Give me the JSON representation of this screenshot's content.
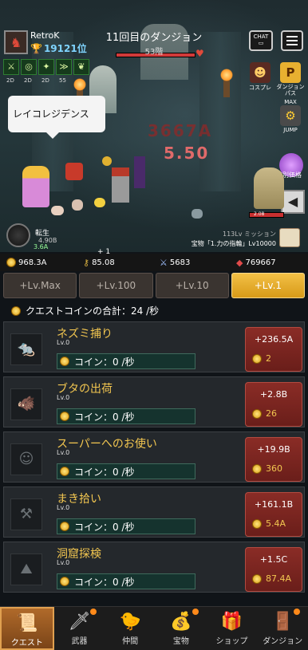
{
  "player": {
    "name": "RetroK",
    "rank": "19121位"
  },
  "dungeon": {
    "title": "11回目のダンジョン",
    "floor": "53階"
  },
  "top_buttons": {
    "chat": "CHAT"
  },
  "buffs": [
    {
      "icon": "crossed-swords-icon",
      "glyph": "⚔",
      "lv": "2D"
    },
    {
      "icon": "coin-buff-icon",
      "glyph": "◎",
      "lv": "2D"
    },
    {
      "icon": "speed-buff-icon",
      "glyph": "✦",
      "lv": "2D"
    },
    {
      "icon": "boots-buff-icon",
      "glyph": "≫",
      "lv": "55"
    },
    {
      "icon": "sprout-buff-icon",
      "glyph": "❦",
      "lv": ""
    }
  ],
  "side_icons": {
    "costume": "コスプレ",
    "dungeon_pass": "ダンジョン パス",
    "jump": "JUMP",
    "max": "MAX",
    "special_price": "特別価格"
  },
  "speech_bubble": "レイコレジデンス",
  "damage": {
    "big": "3667A",
    "small": "5.50"
  },
  "boss_hp_label": "2.08",
  "reincarnation": {
    "label": "転生",
    "value": "4.90B",
    "sub": "3.6A"
  },
  "mission": {
    "line1": "113Lv ミッション",
    "line2": "宝物「1.力の指輪」Lv10000"
  },
  "currency": {
    "coins": "968.3A",
    "keys": "85.08",
    "keys_gain": "+ 1",
    "swords": "5683",
    "gems": "769667"
  },
  "level_tabs": [
    "+Lv.Max",
    "+Lv.100",
    "+Lv.10",
    "+Lv.1"
  ],
  "active_level_tab": 3,
  "quest_total": "クエストコインの合計：24 /秒",
  "quests": [
    {
      "name": "ネズミ捕り",
      "lv": "Lv.0",
      "rate": "コイン：0 /秒",
      "gain": "+236.5A",
      "cost": "2",
      "icon": "rat-icon",
      "glyph": "🐀"
    },
    {
      "name": "ブタの出荷",
      "lv": "Lv.0",
      "rate": "コイン：0 /秒",
      "gain": "+2.8B",
      "cost": "26",
      "icon": "boar-icon",
      "glyph": "🐗"
    },
    {
      "name": "スーパーへのお使い",
      "lv": "Lv.0",
      "rate": "コイン：0 /秒",
      "gain": "+19.9B",
      "cost": "360",
      "icon": "shopping-icon",
      "glyph": "☺"
    },
    {
      "name": "まき拾い",
      "lv": "Lv.0",
      "rate": "コイン：0 /秒",
      "gain": "+161.1B",
      "cost": "5.4A",
      "icon": "firewood-icon",
      "glyph": "⚒"
    },
    {
      "name": "洞窟探検",
      "lv": "Lv.0",
      "rate": "コイン：0 /秒",
      "gain": "+1.5C",
      "cost": "87.4A",
      "icon": "cave-icon",
      "glyph": "⛰"
    }
  ],
  "bottom_nav": [
    {
      "label": "クエスト",
      "icon": "scroll-icon",
      "glyph": "📜",
      "active": true,
      "dot": false
    },
    {
      "label": "武器",
      "icon": "sword-icon",
      "glyph": "🗡",
      "active": false,
      "dot": true
    },
    {
      "label": "仲間",
      "icon": "chick-icon",
      "glyph": "🐤",
      "active": false,
      "dot": false
    },
    {
      "label": "宝物",
      "icon": "treasure-chest-icon",
      "glyph": "💰",
      "active": false,
      "dot": true
    },
    {
      "label": "ショップ",
      "icon": "shop-icon",
      "glyph": "🎁",
      "active": false,
      "dot": false
    },
    {
      "label": "ダンジョン",
      "icon": "dungeon-gate-icon",
      "glyph": "🚪",
      "active": false,
      "dot": true
    }
  ],
  "colors": {
    "accent_gold": "#f2c046",
    "quest_name": "#f2c650",
    "buy_button": "#8a2c26",
    "rate_box": "#15332e"
  }
}
